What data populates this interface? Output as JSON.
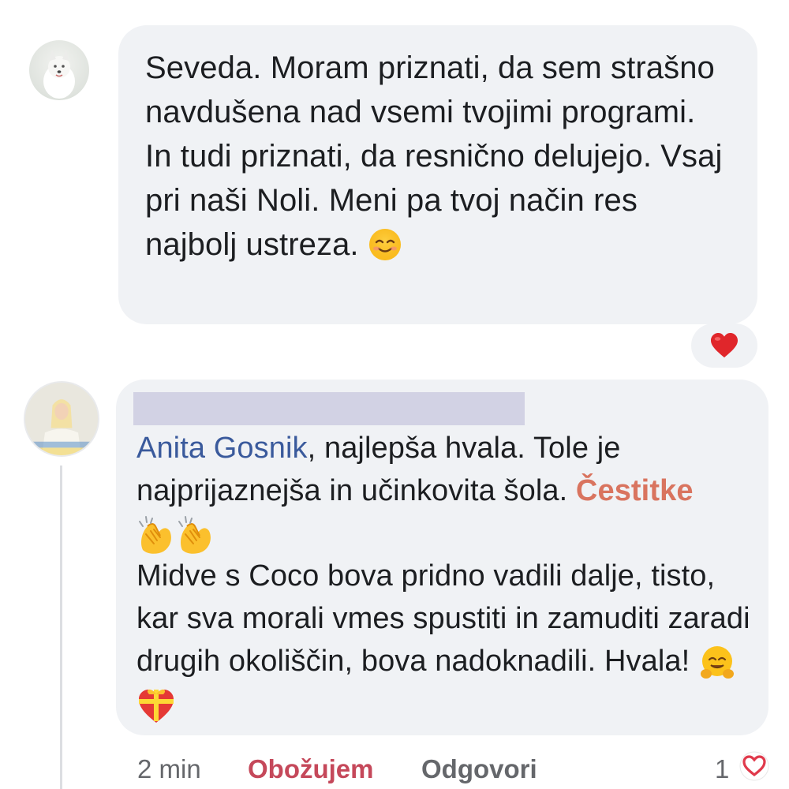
{
  "comments": [
    {
      "avatar": "dog-avatar",
      "text": "Seveda. Moram priznati, da sem strašno navdušena nad vsemi tvojimi programi. In tudi priznati, da resnično delujejo. Vsaj pri naši Noli. Meni pa tvoj način res najbolj ustreza.",
      "emoji": "smiling-face-emoji",
      "reaction": "heart-icon"
    },
    {
      "avatar": "woman-avatar",
      "author": "[redacted]",
      "mention": "Anita Gosnik",
      "text_part1": ", najlepša hvala. Tole je najprijaznejša in učinkovita šola. ",
      "highlight": "Čestitke",
      "text_part2": "Midve s Coco bova pridno vadili dalje, tisto, kar sva morali vmes spustiti in zamuditi zaradi drugih okoliščin, bova nadoknadili. Hvala!",
      "emojis_after_highlight": [
        "clapping-hands-emoji",
        "clapping-hands-emoji"
      ],
      "emojis_end": [
        "hugging-face-emoji",
        "heart-with-ribbon-emoji"
      ]
    }
  ],
  "meta": {
    "time": "2 min",
    "love_label": "Obožujem",
    "reply_label": "Odgovori",
    "reaction_count": "1",
    "reaction_icon": "heart-outline-icon"
  },
  "colors": {
    "bubble": "#f0f2f5",
    "text": "#1c1e21",
    "mention": "#3a5a9c",
    "highlight": "#d9745f",
    "love": "#c5485a",
    "meta": "#65676b"
  }
}
